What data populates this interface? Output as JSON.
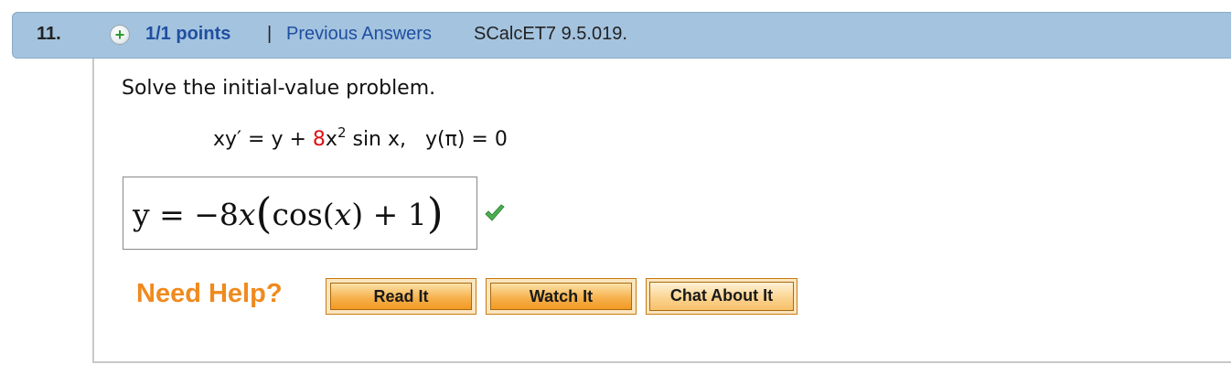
{
  "header": {
    "question_number": "11.",
    "plus_icon": "+",
    "points": "1/1 points",
    "separator": "|",
    "previous_answers": "Previous Answers",
    "problem_code": "SCalcET7 9.5.019."
  },
  "question": {
    "instruction": "Solve the initial-value problem.",
    "equation_left": "xy′ = y + ",
    "equation_coeff": "8",
    "equation_x": "x",
    "equation_exp": "2",
    "equation_right": " sin x,   y(π) = 0"
  },
  "answer": {
    "prefix": "y = −8",
    "x": "x",
    "open_paren": "(",
    "cos_open": "cos(",
    "arg": "x",
    "cos_close": ") + 1",
    "close_paren": ")",
    "status": "correct",
    "status_icon": "check-icon"
  },
  "help": {
    "label": "Need Help?",
    "buttons": [
      "Read It",
      "Watch It",
      "Chat About It"
    ]
  },
  "colors": {
    "header_bg": "#a4c3df",
    "link": "#1f4fa0",
    "highlight": "#e01010",
    "need_help": "#f08a1e",
    "check": "#4caf50"
  }
}
